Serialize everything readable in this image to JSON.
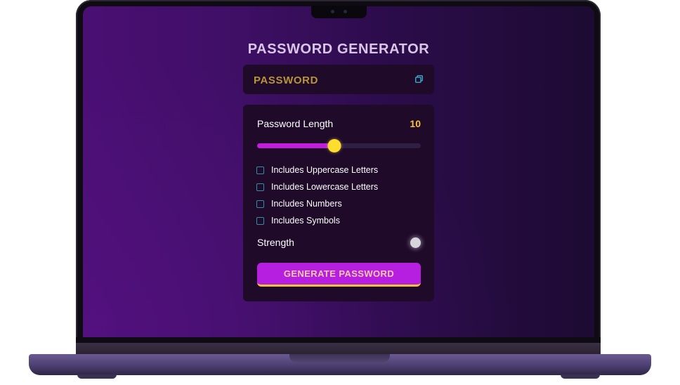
{
  "app": {
    "title": "PASSWORD GENERATOR"
  },
  "password": {
    "value": "PASSWORD",
    "copy_icon": "copy-icon"
  },
  "settings": {
    "length_label": "Password Length",
    "length_value": "10",
    "slider_fraction": 0.47,
    "options": [
      {
        "label": "Includes Uppercase Letters",
        "checked": false
      },
      {
        "label": "Includes Lowercase Letters",
        "checked": false
      },
      {
        "label": "Includes Numbers",
        "checked": false
      },
      {
        "label": "Includes Symbols",
        "checked": false
      }
    ],
    "strength_label": "Strength",
    "strength_color": "#d8d4dc"
  },
  "actions": {
    "generate_label": "GENERATE PASSWORD"
  },
  "colors": {
    "accent": "#c21ddb",
    "thumb": "#ffdd2e",
    "value": "#f7c23a",
    "password_text": "#b89438",
    "checkbox_border": "#2e8fa8"
  }
}
